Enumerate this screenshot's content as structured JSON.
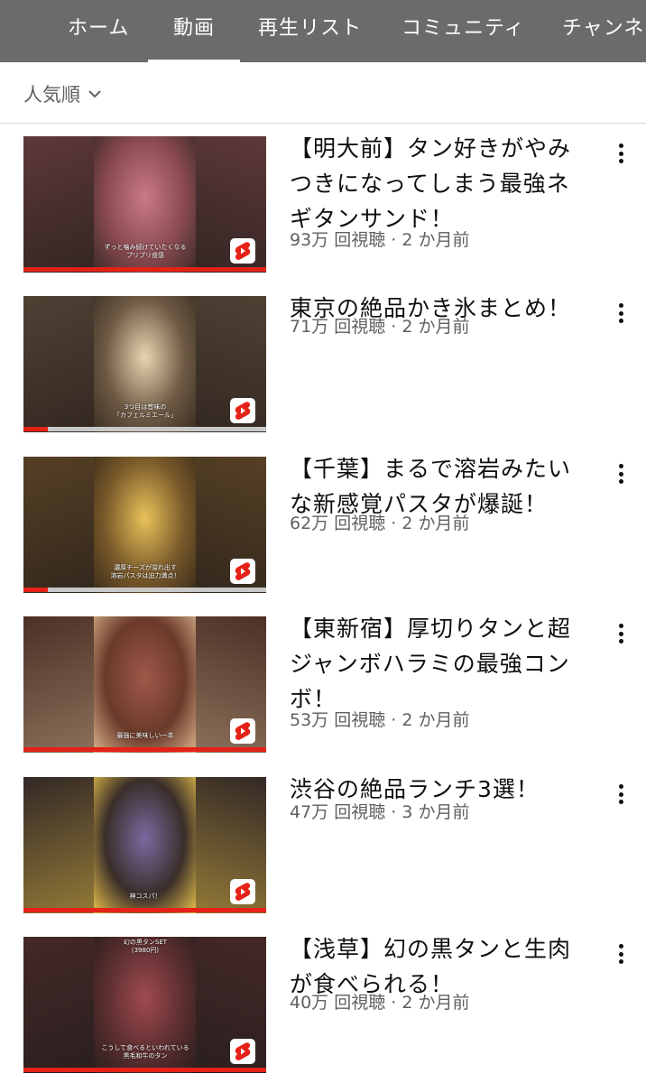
{
  "tabs": [
    {
      "label": "ホーム",
      "active": false
    },
    {
      "label": "動画",
      "active": true
    },
    {
      "label": "再生リスト",
      "active": false
    },
    {
      "label": "コミュニティ",
      "active": false
    },
    {
      "label": "チャンネル",
      "active": false
    }
  ],
  "sort": {
    "label": "人気順",
    "icon": "chevron-down-icon"
  },
  "videos": [
    {
      "title": "【明大前】タン好きがやみつきになってしまう最強ネギタンサンド！",
      "meta": "93万 回視聴 · 2 か月前",
      "thumb_caption": "ずっと噛み続けていたくなる\nプリプリ食感",
      "progress": 1.0,
      "colors": [
        "#8a4a50",
        "#c97a86",
        "#3a2a26"
      ]
    },
    {
      "title": "東京の絶品かき氷まとめ！",
      "meta": "71万 回視聴 · 2 か月前",
      "thumb_caption": "3つ目は昔味の\n「カフェルミエール」",
      "progress": 0.1,
      "colors": [
        "#6e5a44",
        "#e8d4b0",
        "#3a2e22"
      ]
    },
    {
      "title": "【千葉】まるで溶岩みたいな新感覚パスタが爆誕！",
      "meta": "62万 回視聴 · 2 か月前",
      "thumb_caption": "濃厚チーズが溢れ出す\n溶岩パスタは迫力満点！",
      "progress": 0.1,
      "colors": [
        "#7a5a2a",
        "#e8c25a",
        "#3a2c1a"
      ]
    },
    {
      "title": "【東新宿】厚切りタンと超ジャンボハラミの最強コンボ！",
      "meta": "53万 回視聴 · 2 か月前",
      "thumb_caption": "最強に美味しい一本",
      "progress": 1.0,
      "colors": [
        "#6a3a2a",
        "#a0584a",
        "#d9b28a"
      ]
    },
    {
      "title": "渋谷の絶品ランチ3選！",
      "meta": "47万 回視聴 · 3 か月前",
      "thumb_caption": "神コスパ！",
      "progress": 1.0,
      "colors": [
        "#3a2e2a",
        "#7a6aa0",
        "#e8c24a"
      ]
    },
    {
      "title": "【浅草】幻の黒タンと生肉が食べられる！",
      "meta": "40万 回視聴 · 2 か月前",
      "thumb_caption": "こうして食べるといわれている\n黒毛和牛のタン",
      "thumb_top_caption": "幻の黒タンSET\n(3980円)",
      "progress": 1.0,
      "colors": [
        "#5a2e2e",
        "#a04a52",
        "#2a1e1e"
      ]
    }
  ]
}
